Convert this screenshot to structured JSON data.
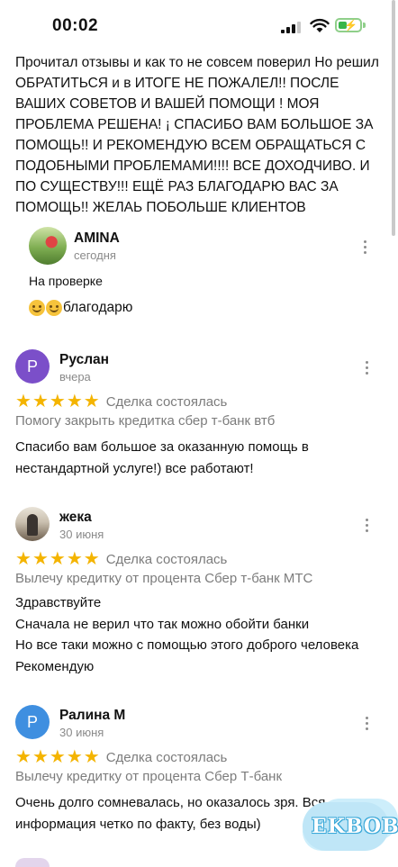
{
  "status_bar": {
    "time": "00:02"
  },
  "top_review": {
    "text": "Прочитал отзывы и как то не совсем поверил Но решил ОБРАТИТЬСЯ и в ИТОГЕ НЕ ПОЖАЛЕЛ!! ПОСЛЕ ВАШИХ СОВЕТОВ И ВАШЕЙ ПОМОЩИ ! МОЯ ПРОБЛЕМА РЕШЕНА! ¡ СПАСИБО ВАМ БОЛЬШОЕ ЗА ПОМОЩЬ!! И РЕКОМЕНДУЮ ВСЕМ ОБРАЩАТЬСЯ С ПОДОБНЫМИ ПРОБЛЕМАМИ!!!! ВСЕ ДОХОДЧИВО. И ПО СУЩЕСТВУ!!! ЕЩЁ РАЗ БЛАГОДАРЮ ВАС ЗА ПОМОЩЬ!! ЖЕЛАЬ ПОБОЛЬШЕ КЛИЕНТОВ"
  },
  "reply": {
    "name": "AMINA",
    "date": "сегодня",
    "line1": "На проверке",
    "line2": "благодарю"
  },
  "reviews": [
    {
      "initial": "Р",
      "avatar_color": "#7b4fc9",
      "name": "Руслан",
      "date": "вчера",
      "rating": 5,
      "deal": "Сделка состоялась",
      "service": "Помогу закрыть кредитка сбер т-банк втб",
      "text": "Спасибо вам большое за оказанную помощь в нестандартной услуге!) все работают!"
    },
    {
      "initial": "",
      "avatar_color": "",
      "name": "жека",
      "date": "30 июня",
      "rating": 5,
      "deal": "Сделка состоялась",
      "service": "Вылечу кредитку от процента Сбер т-банк МТС",
      "lines": [
        "Здравствуйте",
        "Сначала не верил что так можно обойти банки",
        "Но все таки можно с помощью этого доброго человека",
        "Рекомендую"
      ]
    },
    {
      "initial": "Р",
      "avatar_color": "#3f8fe0",
      "name": "Ралина М",
      "date": "30 июня",
      "rating": 5,
      "deal": "Сделка состоялась",
      "service": "Вылечу кредитку от процента Сбер Т-банк",
      "text": "Очень долго сомневалась, но оказалось зря. Вся информация четко по факту, без воды)"
    }
  ],
  "icons": {
    "more": "more-vertical-icon",
    "star": "star-icon",
    "signal": "cellular-signal-icon",
    "wifi": "wifi-icon",
    "battery": "battery-charging-icon"
  },
  "colors": {
    "star": "#f4b400",
    "secondary_text": "#7c7c7c"
  },
  "watermark": {
    "text": "EKBOB"
  }
}
